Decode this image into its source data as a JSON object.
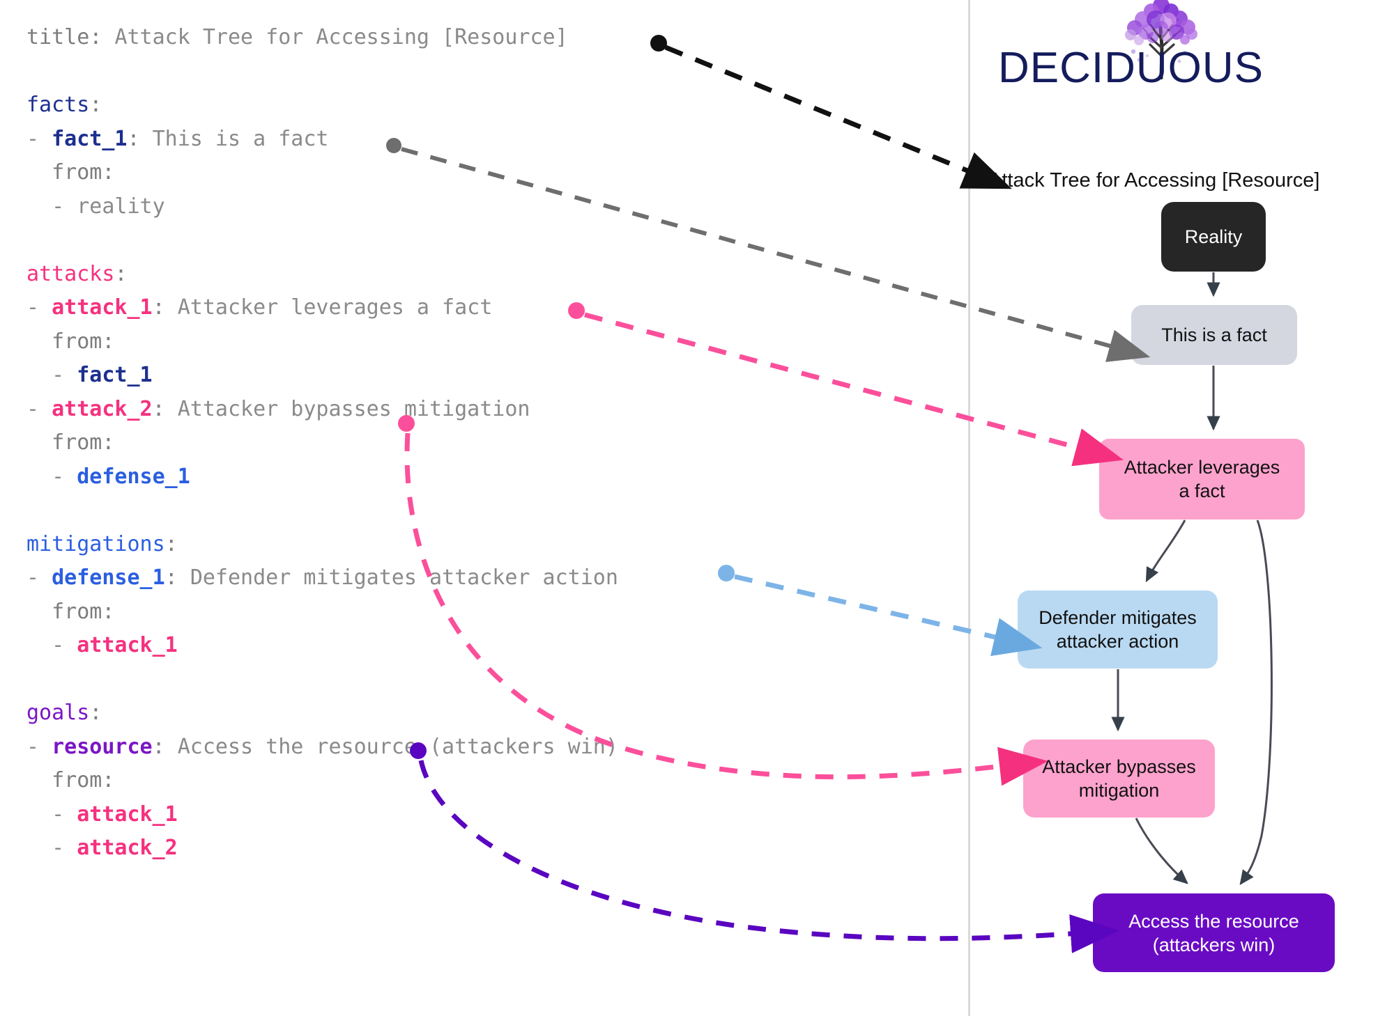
{
  "editor": {
    "lines": [
      {
        "id": "title",
        "segments": [
          {
            "t": "title",
            "c": "k-plain"
          },
          {
            "t": ": ",
            "c": "k-plain"
          },
          {
            "t": "Attack Tree for Accessing [Resource]",
            "c": "k-val"
          }
        ]
      },
      {
        "id": "blank-1",
        "segments": [
          {
            "t": " ",
            "c": "k-plain"
          }
        ]
      },
      {
        "id": "facts-key",
        "segments": [
          {
            "t": "facts",
            "c": "k-section-fact"
          },
          {
            "t": ":",
            "c": "k-plain"
          }
        ]
      },
      {
        "id": "fact-1",
        "segments": [
          {
            "t": "- ",
            "c": "k-dash"
          },
          {
            "t": "fact_1",
            "c": "k-fact"
          },
          {
            "t": ": ",
            "c": "k-plain"
          },
          {
            "t": "This is a fact",
            "c": "k-val"
          }
        ]
      },
      {
        "id": "fact-1-from",
        "segments": [
          {
            "t": "  from:",
            "c": "k-plain"
          }
        ]
      },
      {
        "id": "fact-1-ref",
        "segments": [
          {
            "t": "  - ",
            "c": "k-dash"
          },
          {
            "t": "reality",
            "c": "k-val"
          }
        ]
      },
      {
        "id": "blank-2",
        "segments": [
          {
            "t": " ",
            "c": "k-plain"
          }
        ]
      },
      {
        "id": "attacks-key",
        "segments": [
          {
            "t": "attacks",
            "c": "k-section-attack"
          },
          {
            "t": ":",
            "c": "k-plain"
          }
        ]
      },
      {
        "id": "attack-1",
        "segments": [
          {
            "t": "- ",
            "c": "k-dash"
          },
          {
            "t": "attack_1",
            "c": "k-attack"
          },
          {
            "t": ": ",
            "c": "k-plain"
          },
          {
            "t": "Attacker leverages a fact",
            "c": "k-val"
          }
        ]
      },
      {
        "id": "attack-1-from",
        "segments": [
          {
            "t": "  from:",
            "c": "k-plain"
          }
        ]
      },
      {
        "id": "attack-1-ref",
        "segments": [
          {
            "t": "  - ",
            "c": "k-dash"
          },
          {
            "t": "fact_1",
            "c": "k-fact"
          }
        ]
      },
      {
        "id": "attack-2",
        "segments": [
          {
            "t": "- ",
            "c": "k-dash"
          },
          {
            "t": "attack_2",
            "c": "k-attack"
          },
          {
            "t": ": ",
            "c": "k-plain"
          },
          {
            "t": "Attacker bypasses mitigation",
            "c": "k-val"
          }
        ]
      },
      {
        "id": "attack-2-from",
        "segments": [
          {
            "t": "  from:",
            "c": "k-plain"
          }
        ]
      },
      {
        "id": "attack-2-ref",
        "segments": [
          {
            "t": "  - ",
            "c": "k-dash"
          },
          {
            "t": "defense_1",
            "c": "k-defense"
          }
        ]
      },
      {
        "id": "blank-3",
        "segments": [
          {
            "t": " ",
            "c": "k-plain"
          }
        ]
      },
      {
        "id": "mitigations-key",
        "segments": [
          {
            "t": "mitigations",
            "c": "k-section-defense"
          },
          {
            "t": ":",
            "c": "k-plain"
          }
        ]
      },
      {
        "id": "defense-1",
        "segments": [
          {
            "t": "- ",
            "c": "k-dash"
          },
          {
            "t": "defense_1",
            "c": "k-defense"
          },
          {
            "t": ": ",
            "c": "k-plain"
          },
          {
            "t": "Defender mitigates attacker action",
            "c": "k-val"
          }
        ]
      },
      {
        "id": "defense-1-from",
        "segments": [
          {
            "t": "  from:",
            "c": "k-plain"
          }
        ]
      },
      {
        "id": "defense-1-ref",
        "segments": [
          {
            "t": "  - ",
            "c": "k-dash"
          },
          {
            "t": "attack_1",
            "c": "k-attack"
          }
        ]
      },
      {
        "id": "blank-4",
        "segments": [
          {
            "t": " ",
            "c": "k-plain"
          }
        ]
      },
      {
        "id": "goals-key",
        "segments": [
          {
            "t": "goals",
            "c": "k-section-goal"
          },
          {
            "t": ":",
            "c": "k-plain"
          }
        ]
      },
      {
        "id": "goal-1",
        "segments": [
          {
            "t": "- ",
            "c": "k-dash"
          },
          {
            "t": "resource",
            "c": "k-goal"
          },
          {
            "t": ": ",
            "c": "k-plain"
          },
          {
            "t": "Access the resource (attackers win)",
            "c": "k-val"
          }
        ]
      },
      {
        "id": "goal-1-from",
        "segments": [
          {
            "t": "  from:",
            "c": "k-plain"
          }
        ]
      },
      {
        "id": "goal-1-ref-a",
        "segments": [
          {
            "t": "  - ",
            "c": "k-dash"
          },
          {
            "t": "attack_1",
            "c": "k-attack"
          }
        ]
      },
      {
        "id": "goal-1-ref-b",
        "segments": [
          {
            "t": "  - ",
            "c": "k-dash"
          },
          {
            "t": "attack_2",
            "c": "k-attack"
          }
        ]
      }
    ]
  },
  "logo": {
    "wordmark": "DECIDUOUS",
    "wordmark_color": "#141c5c",
    "tree_colors": [
      "#7b2fd4",
      "#a95de0",
      "#c88ae8",
      "#3a3a3a"
    ]
  },
  "graph": {
    "title": "Attack Tree for Accessing [Resource]",
    "nodes": [
      {
        "id": "reality",
        "label": "Reality",
        "fill": "#262626",
        "text_color": "#ffffff"
      },
      {
        "id": "fact_1",
        "label": "This is a fact",
        "fill": "#d4d6e0",
        "text_color": "#111111"
      },
      {
        "id": "attack_1",
        "label": "Attacker leverages\na fact",
        "fill": "#fda2cd",
        "text_color": "#111111"
      },
      {
        "id": "defense_1",
        "label": "Defender mitigates\nattacker action",
        "fill": "#b9d9f2",
        "text_color": "#111111"
      },
      {
        "id": "attack_2",
        "label": "Attacker bypasses\nmitigation",
        "fill": "#fda2cd",
        "text_color": "#111111"
      },
      {
        "id": "resource",
        "label": "Access the resource\n(attackers win)",
        "fill": "#6a0bc4",
        "text_color": "#ffffff"
      }
    ],
    "edges": [
      {
        "from": "reality",
        "to": "fact_1"
      },
      {
        "from": "fact_1",
        "to": "attack_1"
      },
      {
        "from": "attack_1",
        "to": "defense_1"
      },
      {
        "from": "attack_1",
        "to": "resource"
      },
      {
        "from": "defense_1",
        "to": "attack_2"
      },
      {
        "from": "attack_2",
        "to": "resource"
      }
    ]
  },
  "connectors": [
    {
      "id": "title-connector",
      "color": "#111111",
      "from_line": "title",
      "to_node": "graph-title"
    },
    {
      "id": "fact-connector",
      "color": "#6e6e6e",
      "from_line": "fact-1",
      "to_node": "fact_1"
    },
    {
      "id": "attack1-connector",
      "color": "#f5317f",
      "from_line": "attack-1",
      "to_node": "attack_1"
    },
    {
      "id": "attack2-connector",
      "color": "#f5317f",
      "from_line": "attack-2",
      "to_node": "attack_2"
    },
    {
      "id": "defense1-connector",
      "color": "#6aa9e0",
      "from_line": "defense-1",
      "to_node": "defense_1"
    },
    {
      "id": "goal-connector",
      "color": "#5a06c0",
      "from_line": "goal-1",
      "to_node": "resource"
    }
  ]
}
